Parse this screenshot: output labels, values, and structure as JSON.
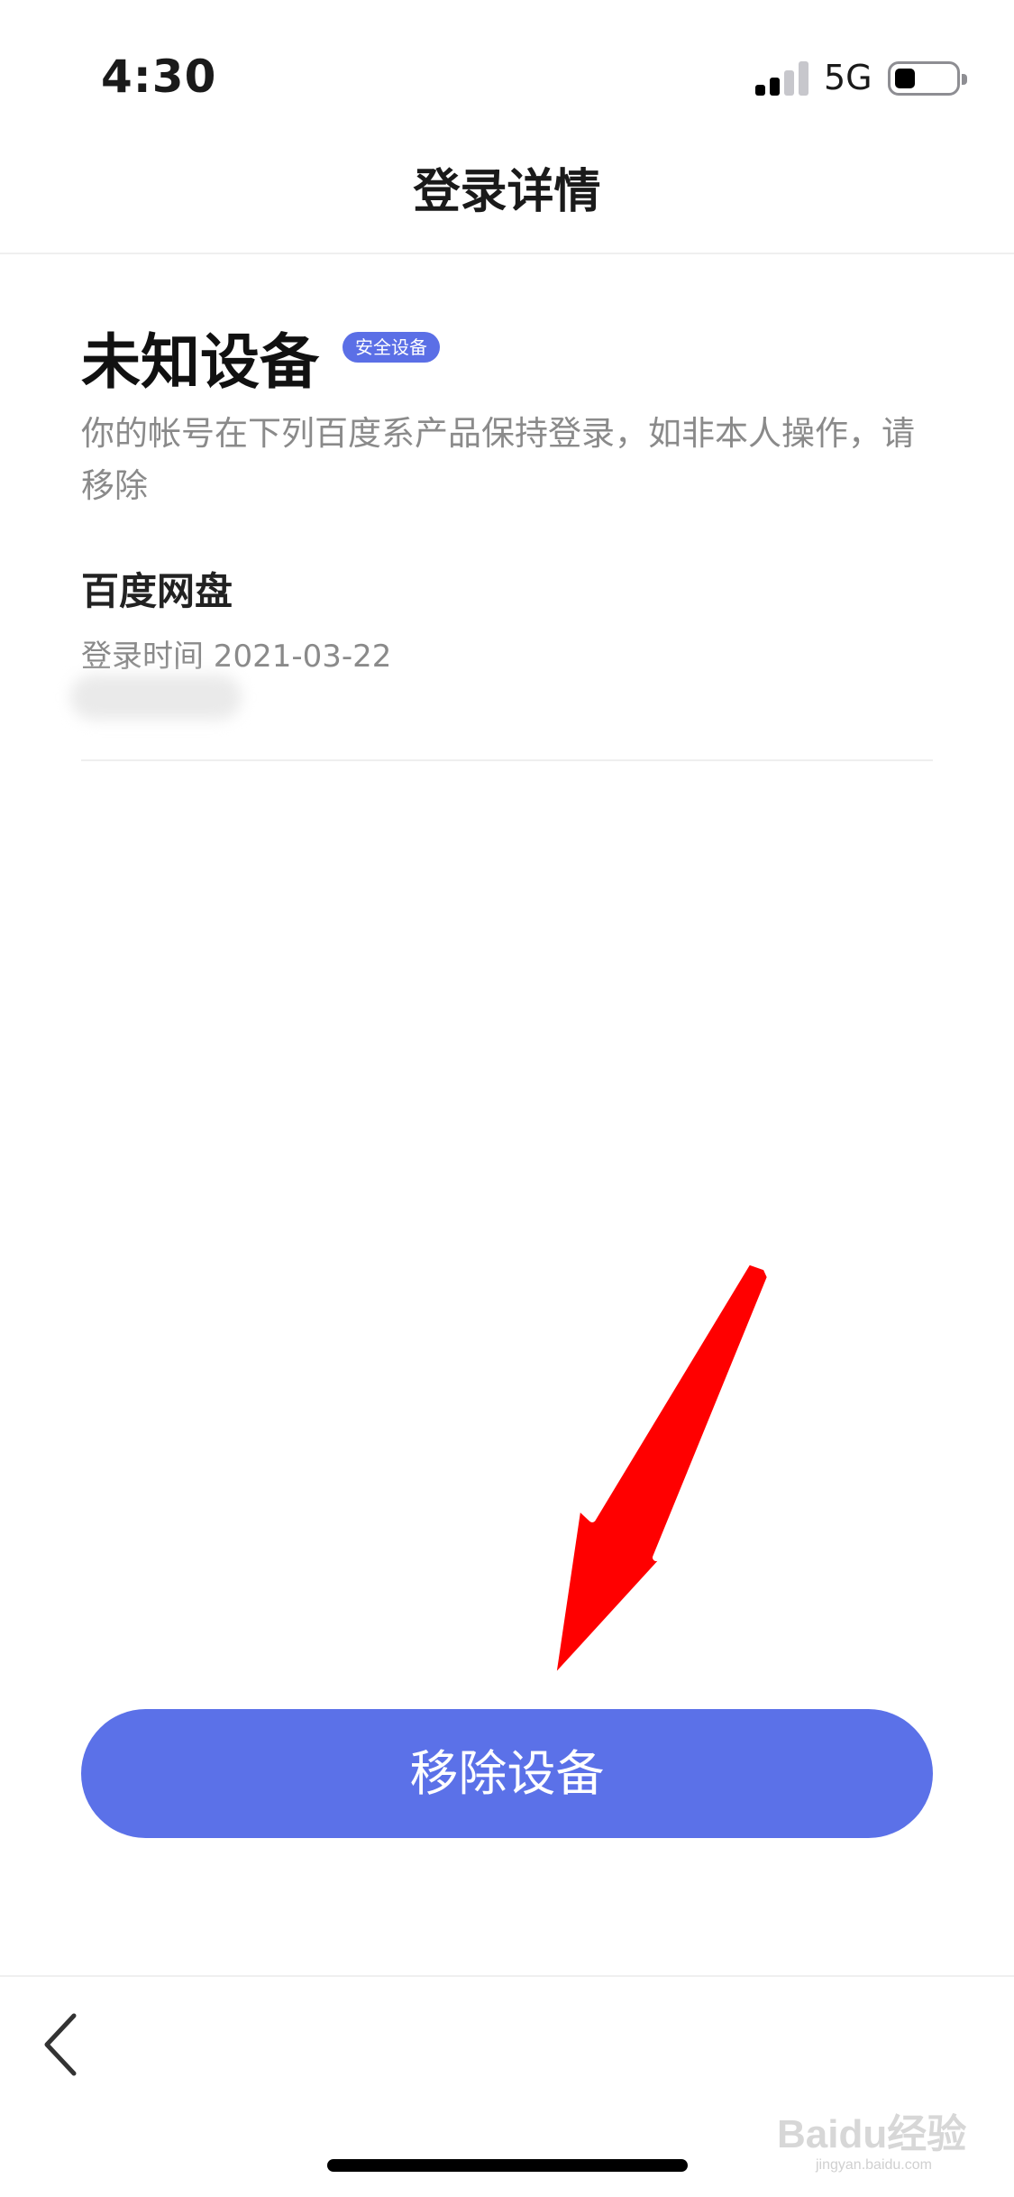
{
  "status_bar": {
    "time": "4:30",
    "network": "5G"
  },
  "nav": {
    "title": "登录详情"
  },
  "device": {
    "title": "未知设备",
    "badge": "安全设备",
    "description": "你的帐号在下列百度系产品保持登录，如非本人操作，请移除",
    "product_name": "百度网盘",
    "login_time": "登录时间 2021-03-22"
  },
  "actions": {
    "remove_label": "移除设备"
  },
  "watermark": {
    "brand": "Baidu经验",
    "url": "jingyan.baidu.com"
  },
  "colors": {
    "accent": "#5b71e8",
    "arrow": "#ff0000"
  }
}
